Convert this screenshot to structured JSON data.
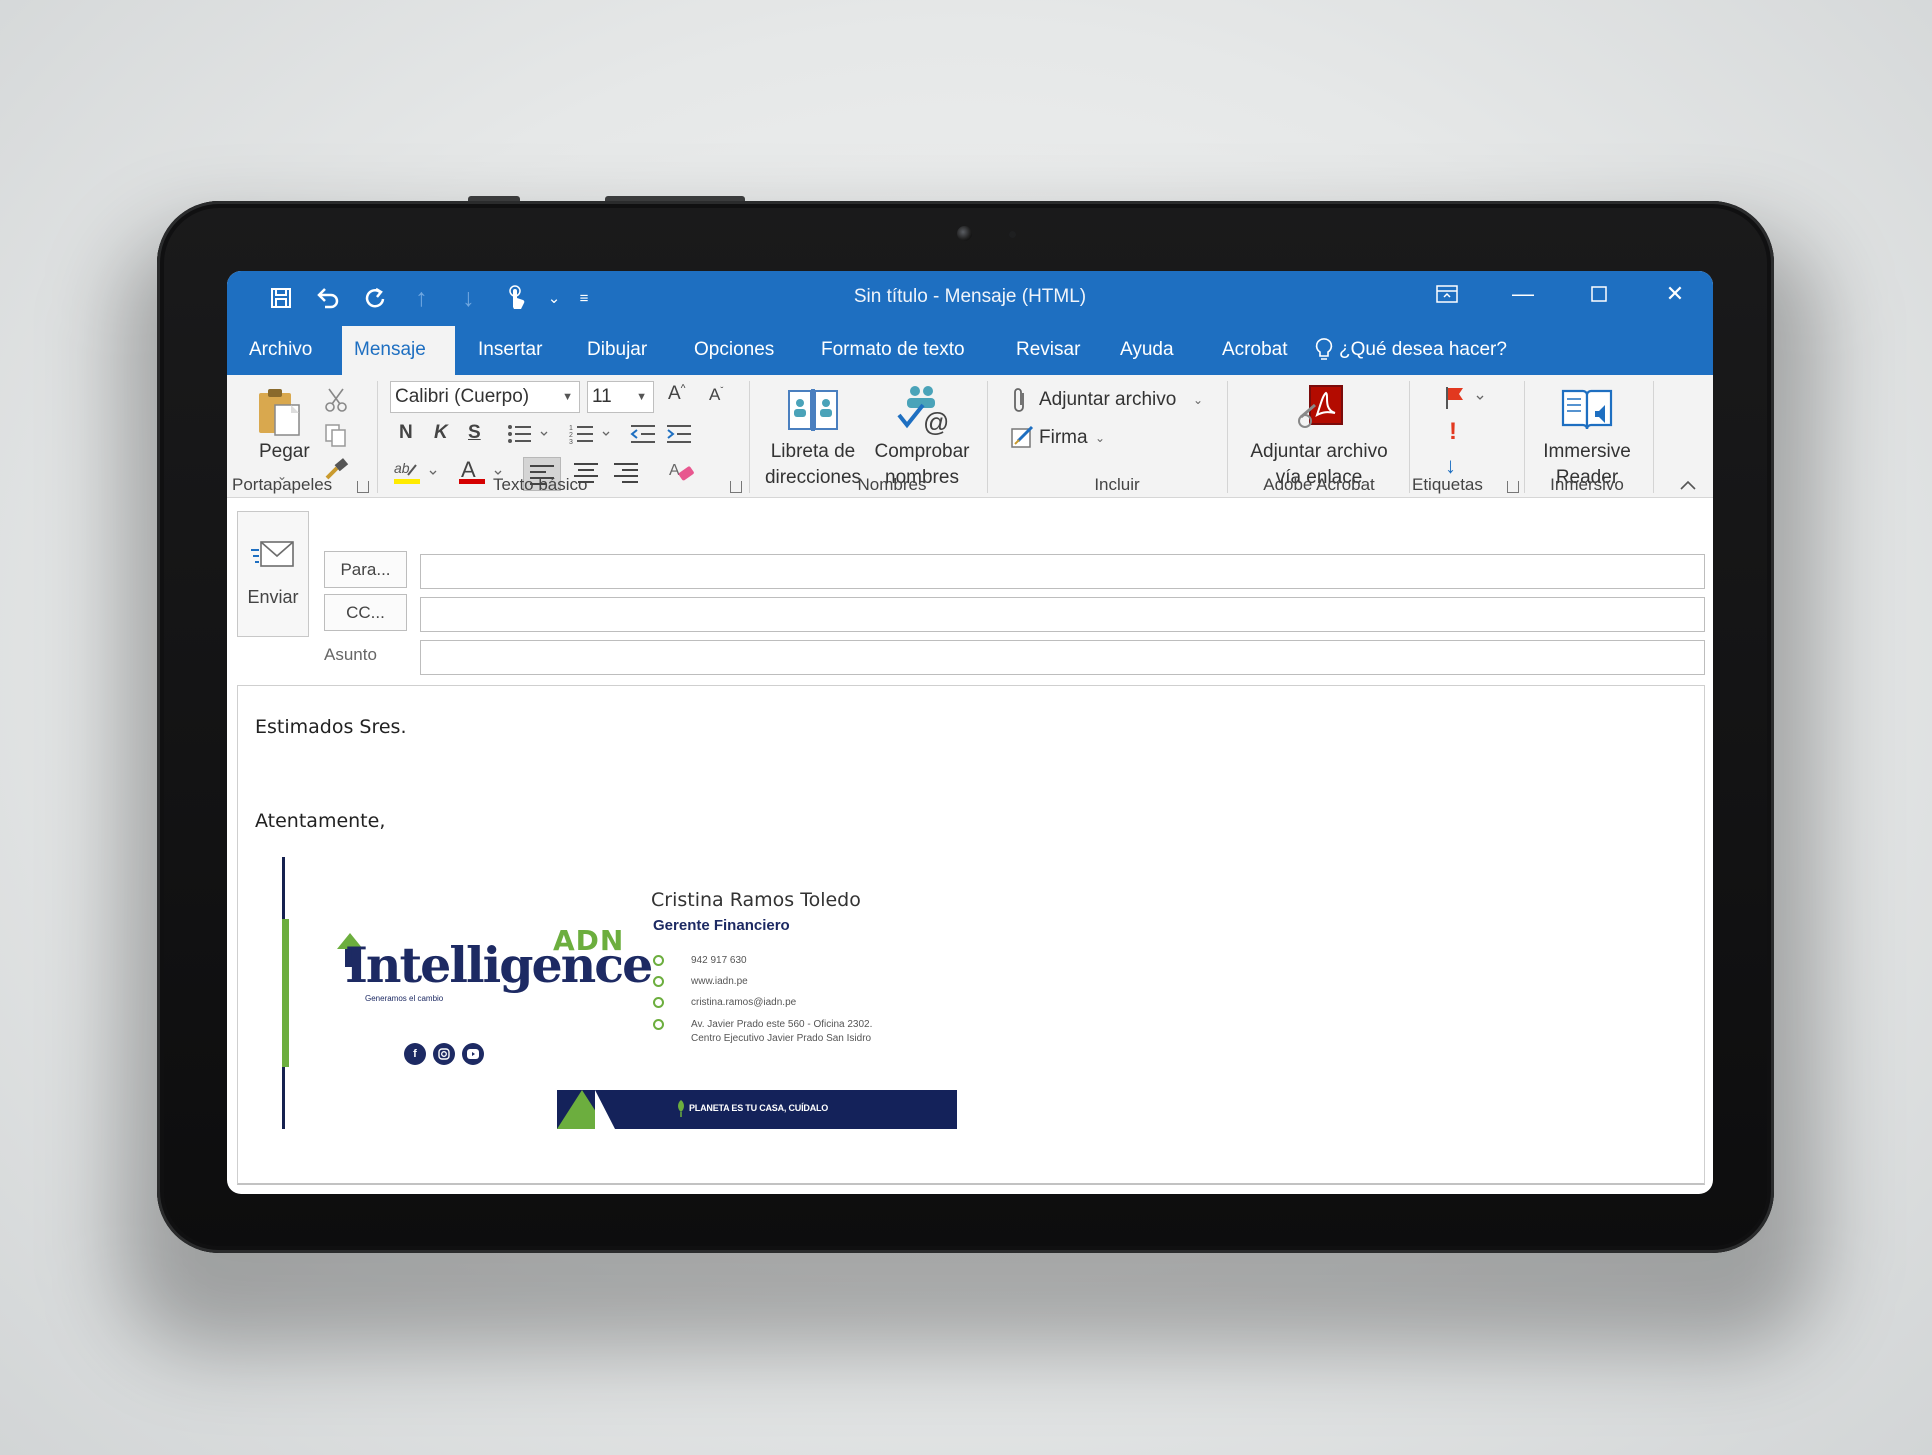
{
  "window": {
    "title": "Sin título  -  Mensaje (HTML)"
  },
  "tabs": [
    "Archivo",
    "Mensaje",
    "Insertar",
    "Dibujar",
    "Opciones",
    "Formato de texto",
    "Revisar",
    "Ayuda",
    "Acrobat"
  ],
  "active_tab": "Mensaje",
  "tell_me": "¿Qué desea hacer?",
  "ribbon": {
    "clipboard": {
      "paste": "Pegar",
      "group": "Portapapeles"
    },
    "basic_text": {
      "font": "Calibri (Cuerpo)",
      "size": "11",
      "bold": "N",
      "italic": "K",
      "underline": "S",
      "group": "Texto básico"
    },
    "names": {
      "address_book_1": "Libreta de",
      "address_book_2": "direcciones",
      "check_names_1": "Comprobar",
      "check_names_2": "nombres",
      "group": "Nombres"
    },
    "include": {
      "attach_file": "Adjuntar archivo",
      "signature": "Firma",
      "group": "Incluir"
    },
    "acrobat": {
      "attach_link_1": "Adjuntar archivo",
      "attach_link_2": "vía enlace",
      "group": "Adobe Acrobat"
    },
    "tags": {
      "group": "Etiquetas"
    },
    "immersive": {
      "reader_1": "Immersive",
      "reader_2": "Reader",
      "group": "Inmersivo"
    }
  },
  "compose": {
    "send": "Enviar",
    "to_button": "Para...",
    "cc_button": "CC...",
    "subject_label": "Asunto",
    "to_value": "",
    "cc_value": "",
    "subject_value": ""
  },
  "body": {
    "greeting": "Estimados Sres.",
    "closing": "Atentamente,"
  },
  "signature": {
    "logo_prefix": "ADN",
    "logo_name": "Intelligence",
    "logo_tagline": "Generamos el cambio",
    "name": "Cristina Ramos Toledo",
    "title": "Gerente Financiero",
    "phone": "942 917 630",
    "web": "www.iadn.pe",
    "email": "cristina.ramos@iadn.pe",
    "address_1": "Av. Javier Prado este 560 - Oficina 2302.",
    "address_2": "Centro Ejecutivo Javier Prado San Isidro",
    "banner": "PLANETA ES TU CASA, CUÍDALO",
    "social": [
      "facebook-icon",
      "instagram-icon",
      "youtube-icon"
    ]
  },
  "colors": {
    "titlebar": "#1e6fc1",
    "brand_navy": "#1d2a63",
    "brand_green": "#6cae3e"
  }
}
